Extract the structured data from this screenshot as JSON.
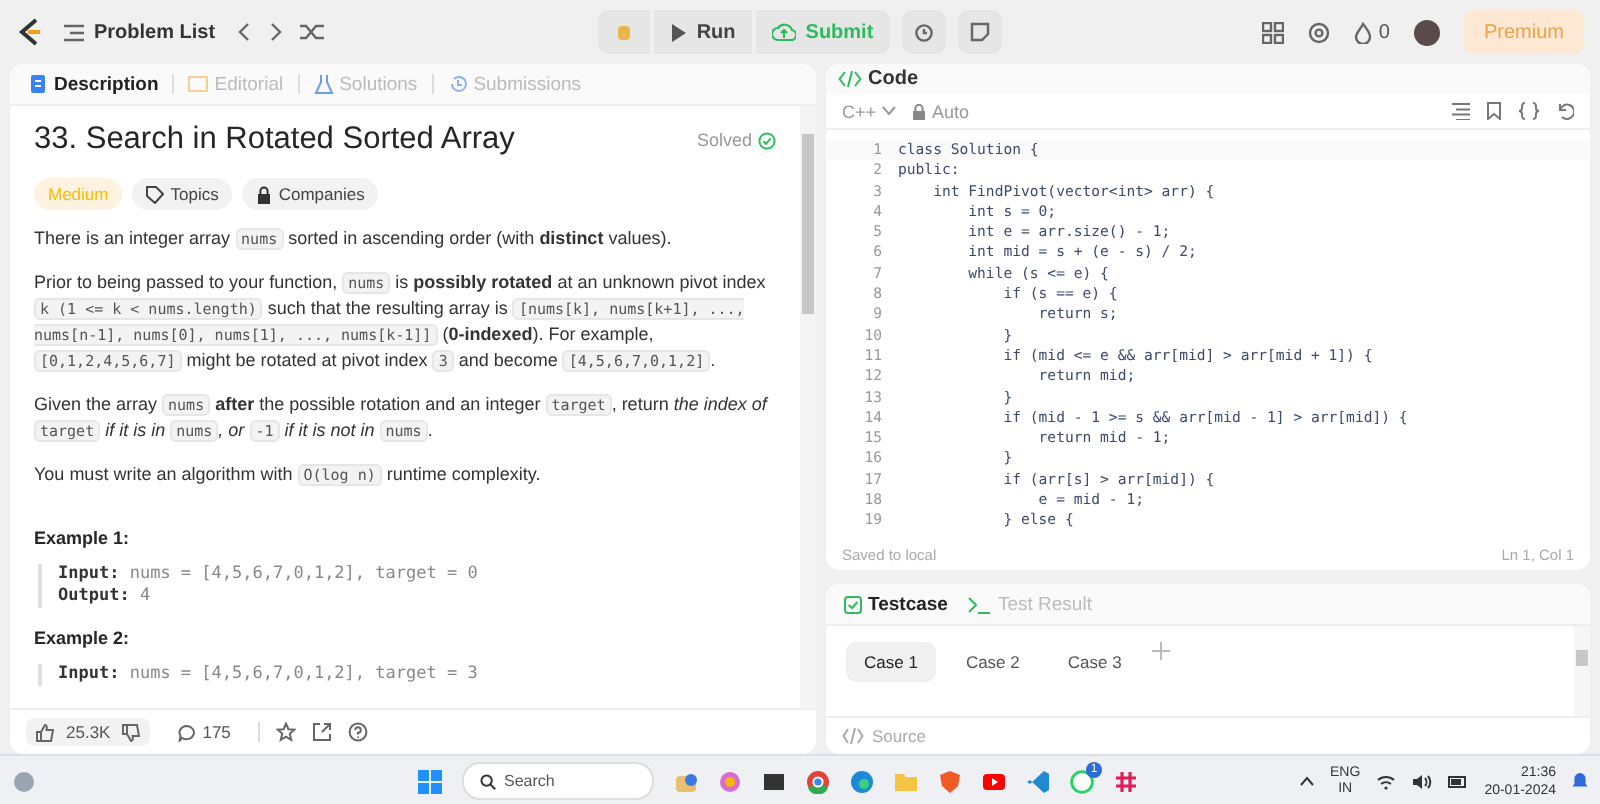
{
  "topbar": {
    "problem_list": "Problem List",
    "run": "Run",
    "submit": "Submit",
    "streak": "0",
    "premium": "Premium"
  },
  "left_tabs": [
    {
      "label": "Description",
      "selected": true
    },
    {
      "label": "Editorial",
      "selected": false
    },
    {
      "label": "Solutions",
      "selected": false
    },
    {
      "label": "Submissions",
      "selected": false
    }
  ],
  "problem": {
    "title": "33. Search in Rotated Sorted Array",
    "status": "Solved",
    "tags": [
      {
        "label": "Medium",
        "kind": "difficulty"
      },
      {
        "label": "Topics",
        "kind": "topics"
      },
      {
        "label": "Companies",
        "kind": "companies"
      }
    ],
    "paragraphs": [
      [
        {
          "kind": "text",
          "text": "There is an integer array "
        },
        {
          "kind": "code",
          "text": "nums"
        },
        {
          "kind": "text",
          "text": " sorted in ascending order (with "
        },
        {
          "kind": "bold",
          "text": "distinct"
        },
        {
          "kind": "text",
          "text": " values)."
        }
      ],
      [
        {
          "kind": "text",
          "text": "Prior to being passed to your function, "
        },
        {
          "kind": "code",
          "text": "nums"
        },
        {
          "kind": "text",
          "text": " is "
        },
        {
          "kind": "bold",
          "text": "possibly rotated"
        },
        {
          "kind": "text",
          "text": " at an unknown pivot index "
        },
        {
          "kind": "code",
          "text": "k (1 <= k < nums.length)"
        },
        {
          "kind": "text",
          "text": " such that the resulting array is "
        },
        {
          "kind": "code",
          "text": "[nums[k], nums[k+1], ..., nums[n-1], nums[0], nums[1], ..., nums[k-1]]"
        },
        {
          "kind": "text",
          "text": " ("
        },
        {
          "kind": "bold",
          "text": "0-indexed"
        },
        {
          "kind": "text",
          "text": "). For example, "
        },
        {
          "kind": "code",
          "text": "[0,1,2,4,5,6,7]"
        },
        {
          "kind": "text",
          "text": " might be rotated at pivot index "
        },
        {
          "kind": "code",
          "text": "3"
        },
        {
          "kind": "text",
          "text": " and become "
        },
        {
          "kind": "code",
          "text": "[4,5,6,7,0,1,2]"
        },
        {
          "kind": "text",
          "text": "."
        }
      ],
      [
        {
          "kind": "text",
          "text": "Given the array "
        },
        {
          "kind": "code",
          "text": "nums"
        },
        {
          "kind": "bold",
          "text": " after"
        },
        {
          "kind": "text",
          "text": " the possible rotation and an integer "
        },
        {
          "kind": "code",
          "text": "target"
        },
        {
          "kind": "text",
          "text": ", return "
        },
        {
          "kind": "italic",
          "text": "the index of "
        },
        {
          "kind": "code",
          "text": "target"
        },
        {
          "kind": "italic",
          "text": " if it is in "
        },
        {
          "kind": "code",
          "text": "nums"
        },
        {
          "kind": "italic",
          "text": ", or "
        },
        {
          "kind": "code",
          "text": "-1"
        },
        {
          "kind": "italic",
          "text": " if it is not in "
        },
        {
          "kind": "code",
          "text": "nums"
        },
        {
          "kind": "text",
          "text": "."
        }
      ],
      [
        {
          "kind": "text",
          "text": "You must write an algorithm with "
        },
        {
          "kind": "code",
          "text": "O(log n)"
        },
        {
          "kind": "text",
          "text": " runtime complexity."
        }
      ]
    ],
    "examples": [
      {
        "title": "Example 1:",
        "lines": [
          {
            "label": "Input:",
            "value": "nums = [4,5,6,7,0,1,2], target = 0"
          },
          {
            "label": "Output:",
            "value": "4"
          }
        ]
      },
      {
        "title": "Example 2:",
        "lines": [
          {
            "label": "Input:",
            "value": "nums = [4,5,6,7,0,1,2], target = 3"
          }
        ]
      }
    ]
  },
  "footer": {
    "likes": "25.3K",
    "comments": "175"
  },
  "code_panel": {
    "title": "Code",
    "language": "C++",
    "mode": "Auto",
    "lines": [
      {
        "number": "1",
        "text": "class Solution {"
      },
      {
        "number": "2",
        "text": "public:"
      },
      {
        "number": "3",
        "text": "    int FindPivot(vector<int> arr) {"
      },
      {
        "number": "4",
        "text": "        int s = 0;"
      },
      {
        "number": "5",
        "text": "        int e = arr.size() - 1;"
      },
      {
        "number": "6",
        "text": "        int mid = s + (e - s) / 2;"
      },
      {
        "number": "7",
        "text": "        while (s <= e) {"
      },
      {
        "number": "8",
        "text": "            if (s == e) {"
      },
      {
        "number": "9",
        "text": "                return s;"
      },
      {
        "number": "10",
        "text": "            }"
      },
      {
        "number": "11",
        "text": "            if (mid <= e && arr[mid] > arr[mid + 1]) {"
      },
      {
        "number": "12",
        "text": "                return mid;"
      },
      {
        "number": "13",
        "text": "            }"
      },
      {
        "number": "14",
        "text": "            if (mid - 1 >= s && arr[mid - 1] > arr[mid]) {"
      },
      {
        "number": "15",
        "text": "                return mid - 1;"
      },
      {
        "number": "16",
        "text": "            }"
      },
      {
        "number": "17",
        "text": "            if (arr[s] > arr[mid]) {"
      },
      {
        "number": "18",
        "text": "                e = mid - 1;"
      },
      {
        "number": "19",
        "text": "            } else {"
      }
    ],
    "status": "Saved to local",
    "cursor": "Ln 1, Col 1"
  },
  "testcase": {
    "tabs": [
      {
        "label": "Testcase",
        "selected": true
      },
      {
        "label": "Test Result",
        "selected": false
      }
    ],
    "cases": [
      {
        "label": "Case 1",
        "selected": true
      },
      {
        "label": "Case 2",
        "selected": false
      },
      {
        "label": "Case 3",
        "selected": false
      }
    ],
    "source": "Source"
  },
  "taskbar": {
    "search": "Search",
    "whatsapp_badge": "1",
    "lang": "ENG",
    "region": "IN",
    "time": "21:36",
    "date": "20-01-2024"
  }
}
